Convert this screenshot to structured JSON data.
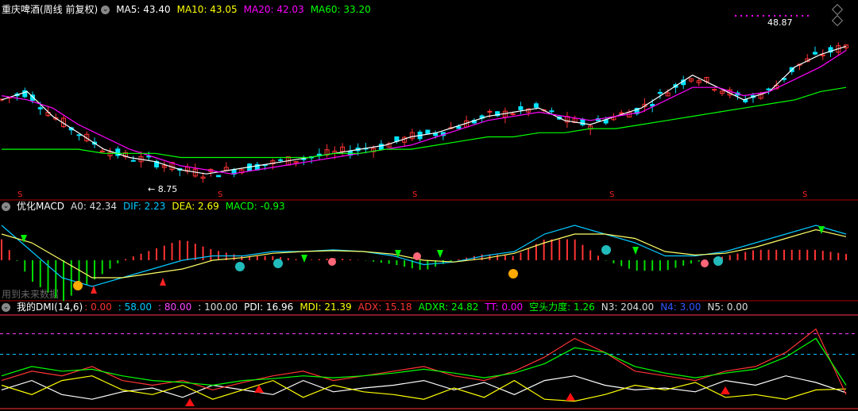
{
  "panel1": {
    "title": "重庆啤酒(周线 前复权)",
    "ma": [
      {
        "label": "MA5: 43.40",
        "color": "#ffffff"
      },
      {
        "label": "MA10: 43.05",
        "color": "#ffff00"
      },
      {
        "label": "MA20: 42.03",
        "color": "#ff00ff"
      },
      {
        "label": "MA60: 33.20",
        "color": "#00ff00"
      }
    ],
    "high_label": "48.87",
    "low_label": "8.75",
    "s_mark": "S"
  },
  "panel2": {
    "title": "优化MACD",
    "values": [
      {
        "label": "A0: 42.34",
        "color": "#dddddd"
      },
      {
        "label": "DIF: 2.23",
        "color": "#00c8ff"
      },
      {
        "label": "DEA: 2.69",
        "color": "#ffff00"
      },
      {
        "label": "MACD: -0.93",
        "color": "#00ff00"
      }
    ],
    "watermark": "用到未来数据"
  },
  "panel3": {
    "title": "我的DMI(14,6)",
    "values": [
      {
        "label": ": 0.00",
        "color": "#ff3333"
      },
      {
        "label": ": 58.00",
        "color": "#00c8ff"
      },
      {
        "label": ": 80.00",
        "color": "#ff44ff"
      },
      {
        "label": ": 100.00",
        "color": "#dddddd"
      },
      {
        "label": "PDI: 16.96",
        "color": "#ffffff"
      },
      {
        "label": "MDI: 21.39",
        "color": "#ffff00"
      },
      {
        "label": "ADX: 15.18",
        "color": "#ff3333"
      },
      {
        "label": "ADXR: 24.82",
        "color": "#00ff00"
      },
      {
        "label": "TT: 0.00",
        "color": "#ff00ff"
      },
      {
        "label": "空头力度: 1.26",
        "color": "#00ff00"
      },
      {
        "label": "N3: 204.00",
        "color": "#dddddd"
      },
      {
        "label": "N4: 3.00",
        "color": "#3355ff"
      },
      {
        "label": "N5: 0.00",
        "color": "#dddddd"
      }
    ]
  },
  "chart_data": [
    {
      "type": "line",
      "title": "重庆啤酒(周线 前复权)",
      "note_series": "weekly candlesticks with moving averages",
      "series": [
        {
          "name": "MA5",
          "values": [
            30,
            32,
            26,
            22,
            18,
            16,
            15,
            13,
            12,
            13,
            14,
            15,
            16,
            17,
            18,
            19,
            21,
            22,
            24,
            26,
            27,
            28,
            25,
            24,
            26,
            28,
            32,
            36,
            33,
            30,
            32,
            38,
            41,
            43
          ]
        },
        {
          "name": "MA20",
          "values": [
            31,
            30,
            28,
            24,
            21,
            18,
            16,
            14,
            13,
            12,
            13,
            14,
            15,
            16,
            17,
            18,
            19,
            21,
            23,
            25,
            26,
            27,
            26,
            25,
            26,
            27,
            30,
            33,
            33,
            31,
            32,
            35,
            38,
            42
          ]
        },
        {
          "name": "MA60",
          "values": [
            18,
            18,
            18,
            18,
            17,
            17,
            17,
            16,
            16,
            16,
            16,
            16,
            16,
            17,
            17,
            18,
            18,
            19,
            20,
            21,
            21,
            22,
            22,
            23,
            23,
            24,
            25,
            26,
            27,
            28,
            29,
            30,
            32,
            33
          ]
        }
      ],
      "ylim": [
        8,
        50
      ]
    },
    {
      "type": "line",
      "title": "优化MACD",
      "series": [
        {
          "name": "DIF",
          "values": [
            4,
            1,
            -2,
            -3,
            -2,
            -1,
            0,
            0.5,
            0.5,
            1,
            1,
            1.2,
            1,
            0.5,
            -0.5,
            -0.2,
            0.5,
            1,
            3,
            4,
            3,
            2,
            0.5,
            0.5,
            1,
            2,
            3,
            4,
            3
          ]
        },
        {
          "name": "DEA",
          "values": [
            3,
            2,
            0,
            -2,
            -2,
            -1.5,
            -1,
            0,
            0.3,
            0.8,
            1,
            1.1,
            1,
            0.7,
            0,
            -0.2,
            0.2,
            0.8,
            2,
            3,
            3,
            2.5,
            1,
            0.6,
            0.8,
            1.5,
            2.5,
            3.5,
            2.7
          ]
        }
      ],
      "ylim": [
        -4,
        6
      ]
    },
    {
      "type": "line",
      "title": "我的DMI(14,6)",
      "series": [
        {
          "name": "PDI",
          "values": [
            20,
            30,
            15,
            10,
            18,
            22,
            12,
            25,
            20,
            15,
            30,
            18,
            22,
            25,
            30,
            20,
            28,
            15,
            30,
            35,
            25,
            20,
            22,
            18,
            30,
            25,
            35,
            28,
            17
          ]
        },
        {
          "name": "MDI",
          "values": [
            25,
            15,
            30,
            35,
            20,
            15,
            25,
            10,
            20,
            30,
            12,
            25,
            18,
            15,
            10,
            22,
            12,
            30,
            10,
            8,
            15,
            25,
            20,
            28,
            12,
            15,
            10,
            20,
            21
          ]
        },
        {
          "name": "ADX",
          "values": [
            30,
            40,
            35,
            45,
            30,
            25,
            30,
            20,
            28,
            35,
            40,
            30,
            35,
            40,
            45,
            35,
            30,
            40,
            55,
            75,
            60,
            40,
            35,
            30,
            40,
            45,
            60,
            85,
            15
          ]
        },
        {
          "name": "ADXR",
          "values": [
            35,
            45,
            40,
            42,
            35,
            30,
            28,
            25,
            30,
            32,
            35,
            33,
            35,
            38,
            42,
            38,
            33,
            38,
            48,
            65,
            60,
            45,
            38,
            33,
            38,
            42,
            55,
            75,
            25
          ]
        }
      ],
      "ylim": [
        0,
        100
      ]
    }
  ]
}
